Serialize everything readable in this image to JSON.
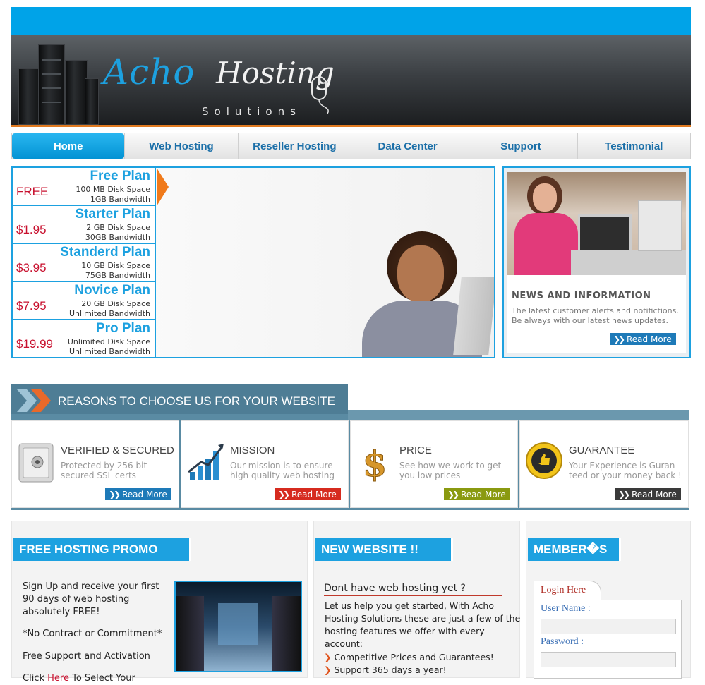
{
  "logo": {
    "part1": "Acho",
    "part2": "Hosting",
    "tagline": "Solutions"
  },
  "nav": [
    {
      "label": "Home",
      "active": true
    },
    {
      "label": "Web Hosting"
    },
    {
      "label": "Reseller Hosting"
    },
    {
      "label": "Data Center"
    },
    {
      "label": "Support"
    },
    {
      "label": "Testimonial"
    }
  ],
  "plans": [
    {
      "price": "FREE",
      "name": "Free Plan",
      "line1": "100 MB Disk Space",
      "line2": "1GB Bandwidth"
    },
    {
      "price": "$1.95",
      "name": "Starter Plan",
      "line1": "2 GB Disk Space",
      "line2": "30GB Bandwidth"
    },
    {
      "price": "$3.95",
      "name": "Standerd Plan",
      "line1": "10 GB Disk Space",
      "line2": "75GB Bandwidth"
    },
    {
      "price": "$7.95",
      "name": "Novice Plan",
      "line1": "20 GB Disk Space",
      "line2": "Unlimited Bandwidth"
    },
    {
      "price": "$19.99",
      "name": "Pro Plan",
      "line1": "Unlimited Disk Space",
      "line2": "Unlimited Bandwidth"
    }
  ],
  "news": {
    "title": "NEWS AND INFORMATION",
    "text": "The latest customer alerts and notifictions. Be always with our latest news updates.",
    "read_more": "Read More"
  },
  "reasons": {
    "title": "REASONS TO CHOOSE US FOR YOUR WEBSITE",
    "items": [
      {
        "title": "VERIFIED & SECURED",
        "text": "Protected by 256 bit secured SSL certs",
        "read_more": "Read More",
        "color": "#1e7ab8"
      },
      {
        "title": "MISSION",
        "text": "Our mission is to ensure high quality web hosting",
        "read_more": "Read More",
        "color": "#d62b1f"
      },
      {
        "title": "PRICE",
        "text": "See how we work to get you low prices",
        "read_more": "Read More",
        "color": "#8a9a10"
      },
      {
        "title": "GUARANTEE",
        "text": "Your Experience is Guran teed or your money back !",
        "read_more": "Read More",
        "color": "#3a3a3a"
      }
    ]
  },
  "promo": {
    "heading": "FREE HOSTING PROMO",
    "p1": "Sign Up and receive your first 90 days of web hosting absolutely FREE!",
    "p2": "*No Contract or Commitment*",
    "p3": "Free Support and Activation",
    "p4_prefix": "Click ",
    "p4_link": "Here",
    "p4_suffix": " To Select Your"
  },
  "newsite": {
    "heading": "NEW WEBSITE !!",
    "subtitle": "Dont have web hosting yet ?",
    "text": "Let us help you get started, With Acho Hosting Solutions these are just a few of the hosting features we offer with every account:",
    "bullets": [
      "Competitive Prices and Guarantees!",
      "Support 365 days a year!"
    ]
  },
  "members": {
    "heading": "MEMBER�S",
    "login_tab": "Login Here",
    "username_label": "User Name :",
    "password_label": "Password :"
  }
}
